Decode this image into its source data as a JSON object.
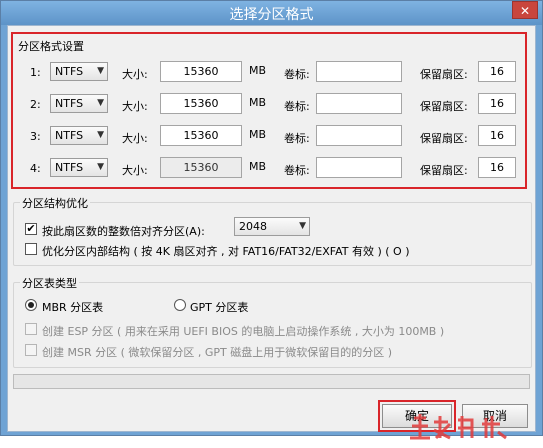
{
  "window": {
    "title": "选择分区格式",
    "close_glyph": "✕"
  },
  "format_section": {
    "title": "分区格式设置",
    "size_label": "大小:",
    "unit": "MB",
    "volume_label": "卷标:",
    "reserved_label": "保留扇区:",
    "rows": [
      {
        "index": "1:",
        "fs": "NTFS",
        "size": "15360",
        "volume": "",
        "reserved": "16",
        "size_disabled": false
      },
      {
        "index": "2:",
        "fs": "NTFS",
        "size": "15360",
        "volume": "",
        "reserved": "16",
        "size_disabled": false
      },
      {
        "index": "3:",
        "fs": "NTFS",
        "size": "15360",
        "volume": "",
        "reserved": "16",
        "size_disabled": false
      },
      {
        "index": "4:",
        "fs": "NTFS",
        "size": "15360",
        "volume": "",
        "reserved": "16",
        "size_disabled": true
      }
    ]
  },
  "structure_section": {
    "title": "分区结构优化",
    "align_label": "按此扇区数的整数倍对齐分区(A):",
    "align_checked": true,
    "align_value": "2048",
    "optimize_label": "优化分区内部结构 ( 按 4K 扇区对齐 , 对 FAT16/FAT32/EXFAT 有效 ) ( O )",
    "optimize_checked": false
  },
  "table_section": {
    "title": "分区表类型",
    "mbr_label": "MBR 分区表",
    "gpt_label": "GPT 分区表",
    "selected": "MBR",
    "esp_label": "创建 ESP 分区 ( 用来在采用 UEFI BIOS 的电脑上启动操作系统 , 大小为 100MB )",
    "msr_label": "创建 MSR 分区 ( 微软保留分区 , GPT 磁盘上用于微软保留目的的分区 )"
  },
  "buttons": {
    "ok": "确定",
    "cancel": "取消"
  },
  "icons": {
    "dropdown": "▼",
    "check": "✔"
  },
  "colors": {
    "highlight": "#d9252a",
    "titlebar": "#6fa3d4"
  }
}
